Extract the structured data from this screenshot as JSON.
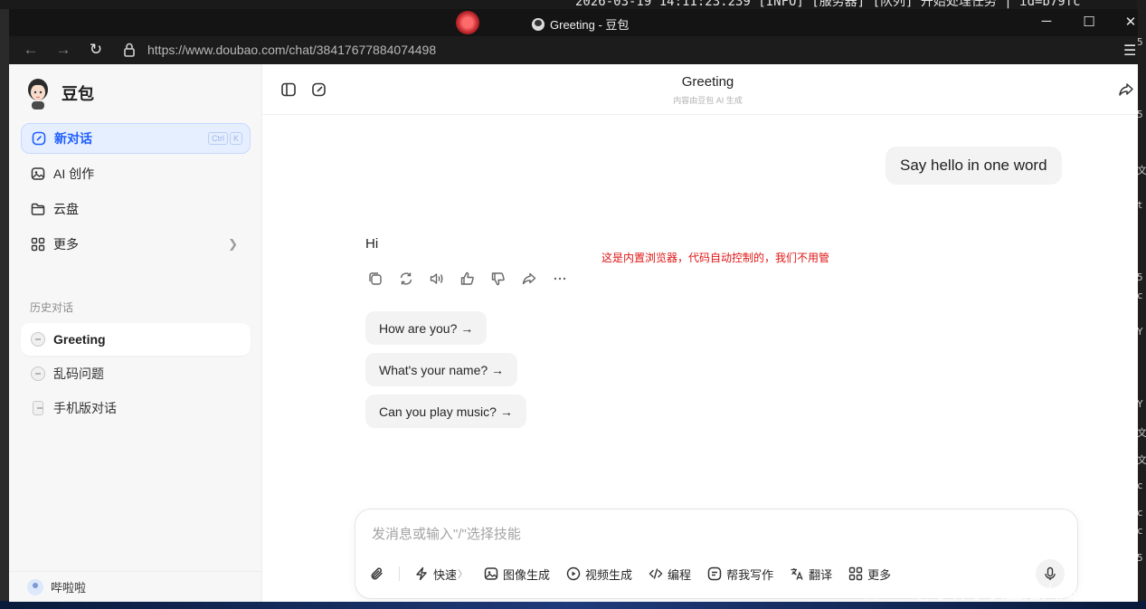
{
  "desktop": {
    "terminal_line": "2026-03-19 14:11:23.239 [INFO] [服务器] [队列] 开始处理任务 | id=b79fc",
    "right_edge_chars": [
      "5",
      "5",
      "文",
      "t",
      "5",
      "c",
      "Y",
      "Y",
      "文",
      "文",
      "c",
      "c",
      "c",
      "5"
    ]
  },
  "window": {
    "title": "Greeting - 豆包",
    "url": "https://www.doubao.com/chat/38417677884074498",
    "controls": {
      "minimize": "─",
      "maximize": "☐",
      "close": "✕"
    }
  },
  "sidebar": {
    "brand": "豆包",
    "new_chat": {
      "label": "新对话",
      "shortcut": [
        "Ctrl",
        "K"
      ]
    },
    "items": [
      {
        "label": "AI 创作",
        "icon": "image-icon"
      },
      {
        "label": "云盘",
        "icon": "folder-icon"
      },
      {
        "label": "更多",
        "icon": "grid-icon"
      }
    ],
    "history_label": "历史对话",
    "history": [
      {
        "label": "Greeting",
        "active": true
      },
      {
        "label": "乱码问题",
        "active": false
      },
      {
        "label": "手机版对话",
        "active": false
      }
    ],
    "user_name": "哔啦啦"
  },
  "chat": {
    "title": "Greeting",
    "subtitle": "内容由豆包 AI 生成",
    "user_message": "Say hello in one word",
    "assistant_message": "Hi",
    "annotation": "这是内置浏览器，代码自动控制的，我们不用管",
    "suggestions": [
      "How are you? →",
      "What's your name? →",
      "Can you play music? →"
    ]
  },
  "composer": {
    "placeholder": "发消息或输入\"/\"选择技能",
    "tools": [
      {
        "label": "快速",
        "icon": "bolt-icon",
        "suffix": "〉"
      },
      {
        "label": "图像生成",
        "icon": "image-icon"
      },
      {
        "label": "视频生成",
        "icon": "video-icon"
      },
      {
        "label": "编程",
        "icon": "code-icon"
      },
      {
        "label": "帮我写作",
        "icon": "write-icon"
      },
      {
        "label": "翻译",
        "icon": "translate-icon"
      },
      {
        "label": "更多",
        "icon": "grid-icon"
      }
    ]
  },
  "watermark": "CSDN @小锋学长生活大爆炸",
  "colors": {
    "accent": "#1f5eff",
    "annotation": "#e01515",
    "bubble": "#f3f3f4"
  }
}
